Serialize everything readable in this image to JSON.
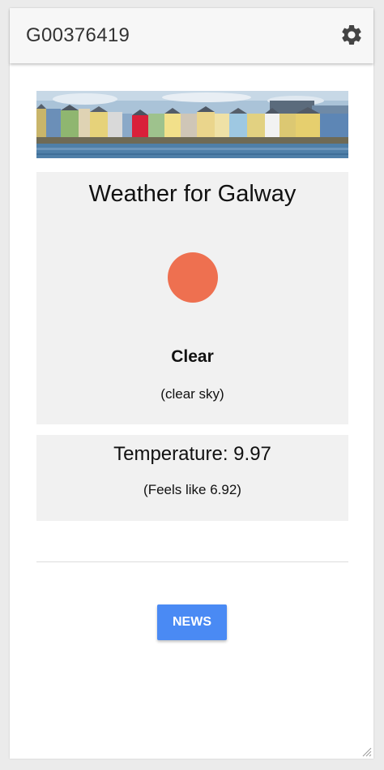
{
  "toolbar": {
    "title": "G00376419",
    "settings_icon": "gear-icon"
  },
  "banner": {
    "image": "galway-waterfront-houses"
  },
  "weather": {
    "title": "Weather for Galway",
    "main": "Clear",
    "description": "(clear sky)",
    "icon_color": "#ee7050"
  },
  "temperature": {
    "main": "Temperature: 9.97",
    "feels_like": "(Feels like 6.92)"
  },
  "actions": {
    "news_label": "NEWS",
    "news_color": "#4a8af4"
  }
}
